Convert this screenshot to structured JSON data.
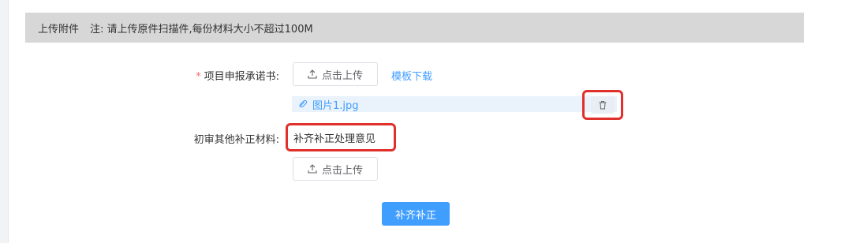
{
  "header": {
    "title": "上传附件",
    "note": "注: 请上传原件扫描件,每份材料大小不超过100M"
  },
  "commitment": {
    "required_mark": "*",
    "label": "项目申报承诺书:",
    "upload_label": "点击上传",
    "template_link": "模板下载",
    "file_name": "图片1.jpg"
  },
  "other_materials": {
    "label": "初审其他补正材料:",
    "text": "补齐补正处理意见",
    "upload_label": "点击上传"
  },
  "submit": {
    "label": "补齐补正"
  },
  "colors": {
    "primary": "#409eff",
    "required": "#f56c6c",
    "highlight": "#e0302b",
    "header_bg": "#d7d7d7"
  },
  "icons": {
    "upload": "upload-icon",
    "attachment": "paperclip-icon",
    "delete": "trash-icon"
  }
}
